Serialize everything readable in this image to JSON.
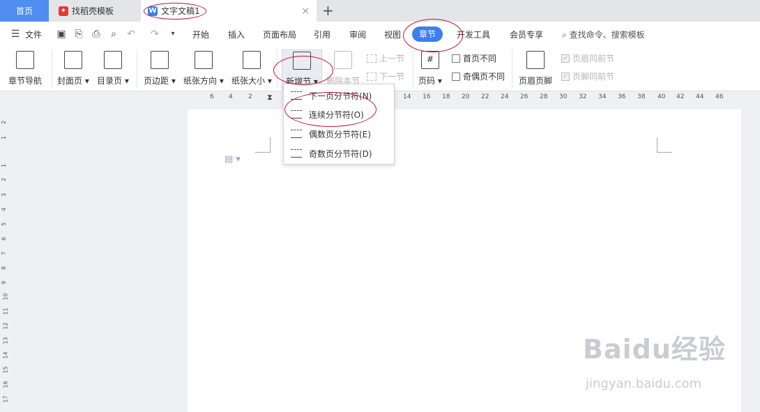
{
  "tabs": {
    "home": "首页",
    "tab1": "找稻壳模板",
    "tab2": "文字文稿1",
    "add": "+",
    "close": "×"
  },
  "menu": {
    "file": "文件",
    "items": [
      "开始",
      "插入",
      "页面布局",
      "引用",
      "审阅",
      "视图",
      "章节",
      "开发工具",
      "会员专享"
    ],
    "search": "查找命令、搜索模板"
  },
  "ribbon": {
    "nav": "章节导航",
    "cover": "封面页",
    "toc": "目录页",
    "margin": "页边距",
    "orientation": "纸张方向",
    "size": "纸张大小",
    "new_section": "新增节",
    "delete_section": "删除本节",
    "prev_section": "上一节",
    "next_section": "下一节",
    "page_number": "页码",
    "first_page_diff": "首页不同",
    "odd_even_diff": "奇偶页不同",
    "header_footer": "页眉页脚",
    "header_same": "页眉同前节",
    "footer_same": "页脚同前节"
  },
  "dropdown": [
    "下一页分节符(N)",
    "连续分节符(O)",
    "偶数页分节符(E)",
    "奇数页分节符(D)"
  ],
  "hruler": [
    "6",
    "4",
    "2",
    "14",
    "16",
    "18",
    "20",
    "22",
    "24",
    "26",
    "28",
    "30",
    "32",
    "34",
    "36",
    "38",
    "40",
    "42",
    "44",
    "46"
  ],
  "vruler": [
    "2",
    "1",
    "1",
    "2",
    "3",
    "4",
    "5",
    "6",
    "7",
    "8",
    "9",
    "10",
    "11",
    "12",
    "13",
    "14",
    "15",
    "16",
    "17"
  ],
  "watermark": {
    "logo": "Baidu经验",
    "url": "jingyan.baidu.com"
  },
  "colors": {
    "accent": "#3b7ff0",
    "annotation": "#c8102e"
  }
}
